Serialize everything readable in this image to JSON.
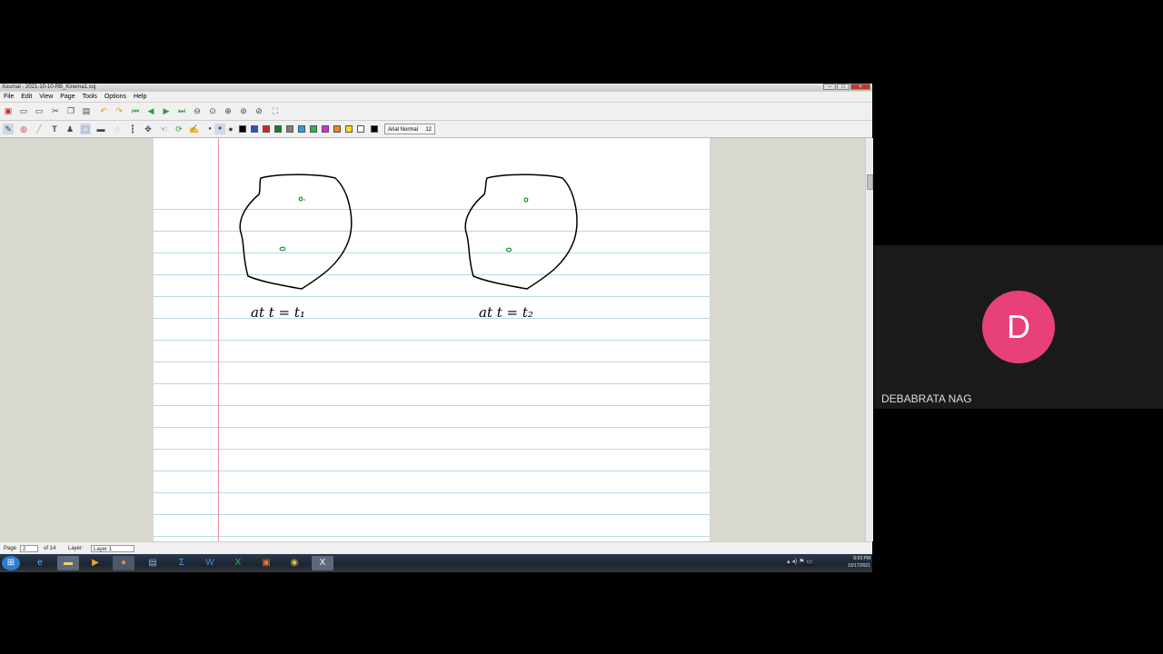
{
  "window": {
    "title": "Xournal - 2021-10-10-RB_Kinema1.xoj"
  },
  "menu": [
    "File",
    "Edit",
    "View",
    "Page",
    "Tools",
    "Options",
    "Help"
  ],
  "toolbar": {
    "font_label": "Arial Normal",
    "font_size": "12",
    "pen_colors": [
      "#000000",
      "#3050c0",
      "#e02020",
      "#108030",
      "#808080",
      "#20a0e0",
      "#20c040",
      "#e020e0",
      "#f08020",
      "#f0e020",
      "#ffffff",
      "#000000"
    ]
  },
  "notes": {
    "label_left": "at  t = t₁",
    "label_right": "at  t = t₂"
  },
  "status": {
    "page_label": "Page",
    "page_value": "2",
    "page_of": "of 14",
    "layer_label": "Layer:",
    "layer_value": "Layer 1"
  },
  "taskbar": {
    "time": "6:03 PM",
    "date": "10/17/2021"
  },
  "participant": {
    "initial": "D",
    "name": "DEBABRATA NAG",
    "avatar_color": "#e8417a"
  }
}
